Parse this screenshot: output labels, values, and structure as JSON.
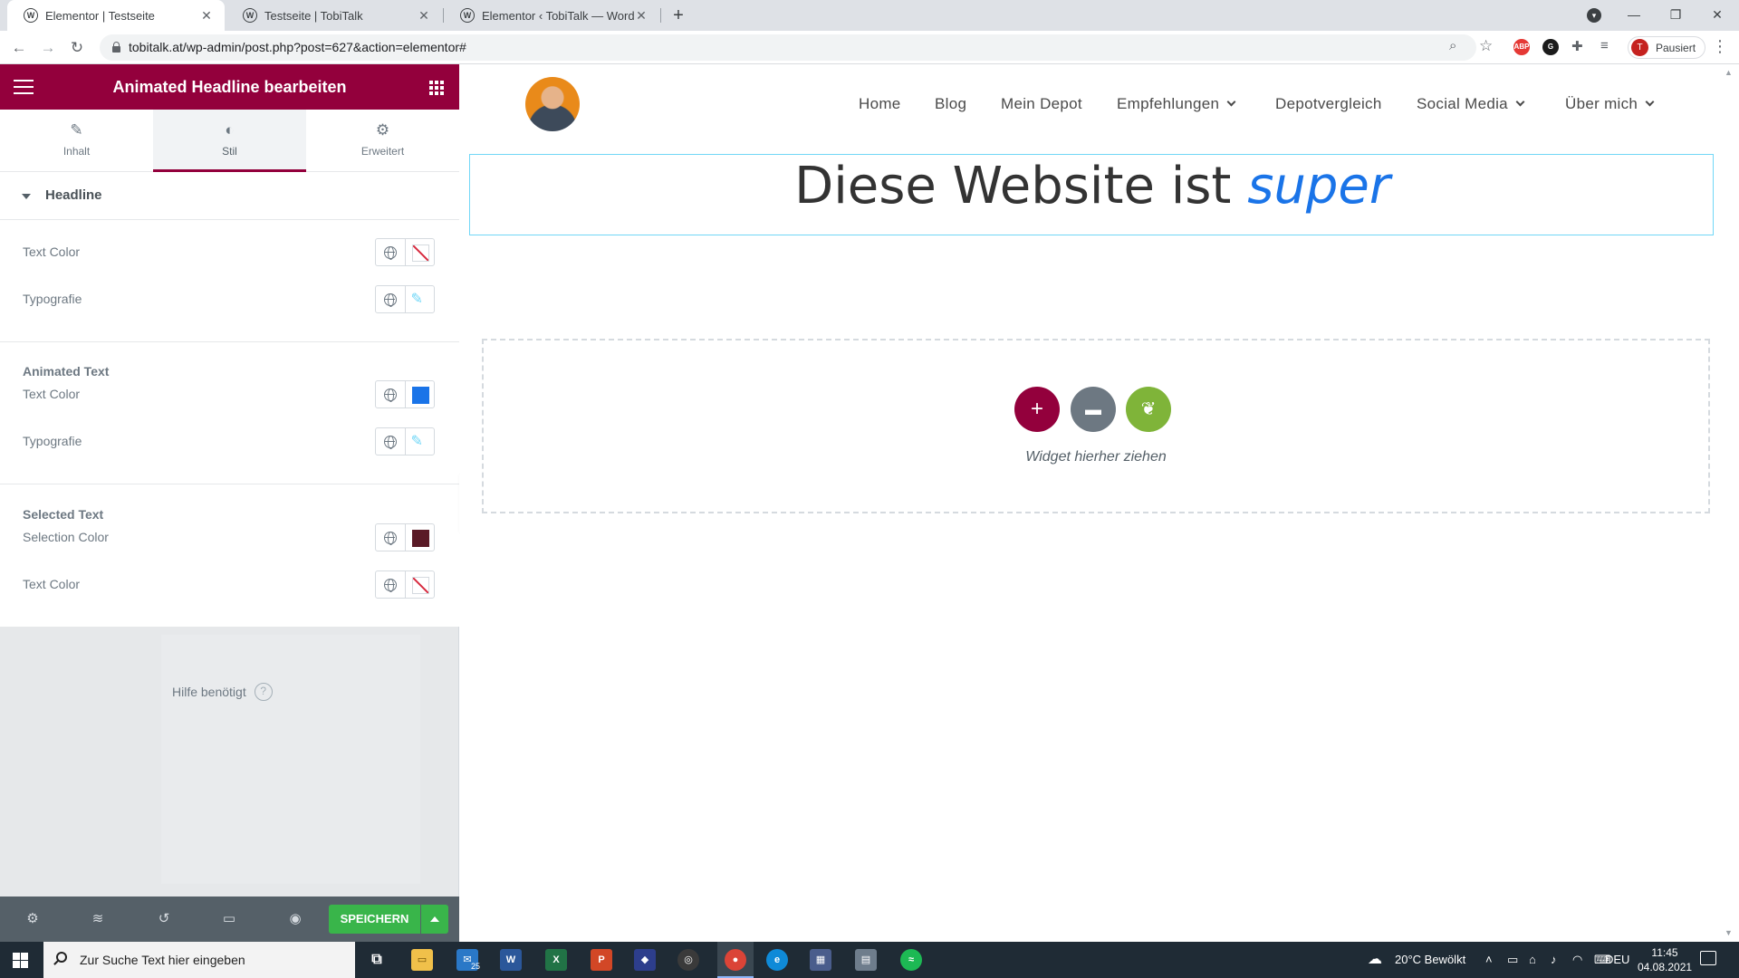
{
  "browser": {
    "tabs": [
      {
        "label": "Elementor | Testseite",
        "active": true
      },
      {
        "label": "Testseite | TobiTalk",
        "active": false
      },
      {
        "label": "Elementor ‹ TobiTalk — WordPre",
        "active": false
      }
    ],
    "url": "tobitalk.at/wp-admin/post.php?post=627&action=elementor#",
    "profile_label": "Pausiert",
    "profile_initial": "T"
  },
  "panel": {
    "title": "Animated Headline bearbeiten",
    "tabs": [
      {
        "label": "Inhalt",
        "icon": "pencil-icon"
      },
      {
        "label": "Stil",
        "icon": "half-circle-icon"
      },
      {
        "label": "Erweitert",
        "icon": "gear-icon"
      }
    ],
    "section_title": "Headline",
    "groups": {
      "headline": {
        "text_color_label": "Text Color",
        "typography_label": "Typografie"
      },
      "animated_text": {
        "title": "Animated Text",
        "text_color_label": "Text Color",
        "text_color_value": "#1a74e8",
        "typography_label": "Typografie"
      },
      "selected_text": {
        "title": "Selected Text",
        "selection_color_label": "Selection Color",
        "selection_color_value": "#5a1a26",
        "text_color_label": "Text Color"
      }
    },
    "help_label": "Hilfe benötigt",
    "footer": {
      "save_label": "SPEICHERN"
    }
  },
  "site": {
    "nav": [
      "Home",
      "Blog",
      "Mein Depot",
      "Empfehlungen",
      "Depotvergleich",
      "Social Media",
      "Über mich"
    ],
    "headline_static": "Diese Website ist ",
    "headline_animated": "super",
    "drop_text": "Widget hierher ziehen"
  },
  "taskbar": {
    "search_placeholder": "Zur Suche Text hier eingeben",
    "mail_badge": "25",
    "weather": "20°C  Bewölkt",
    "language": "DEU",
    "time": "11:45",
    "date": "04.08.2021"
  },
  "colors": {
    "brand": "#93003c",
    "save": "#39b54a",
    "animated_text": "#1a74e8"
  }
}
